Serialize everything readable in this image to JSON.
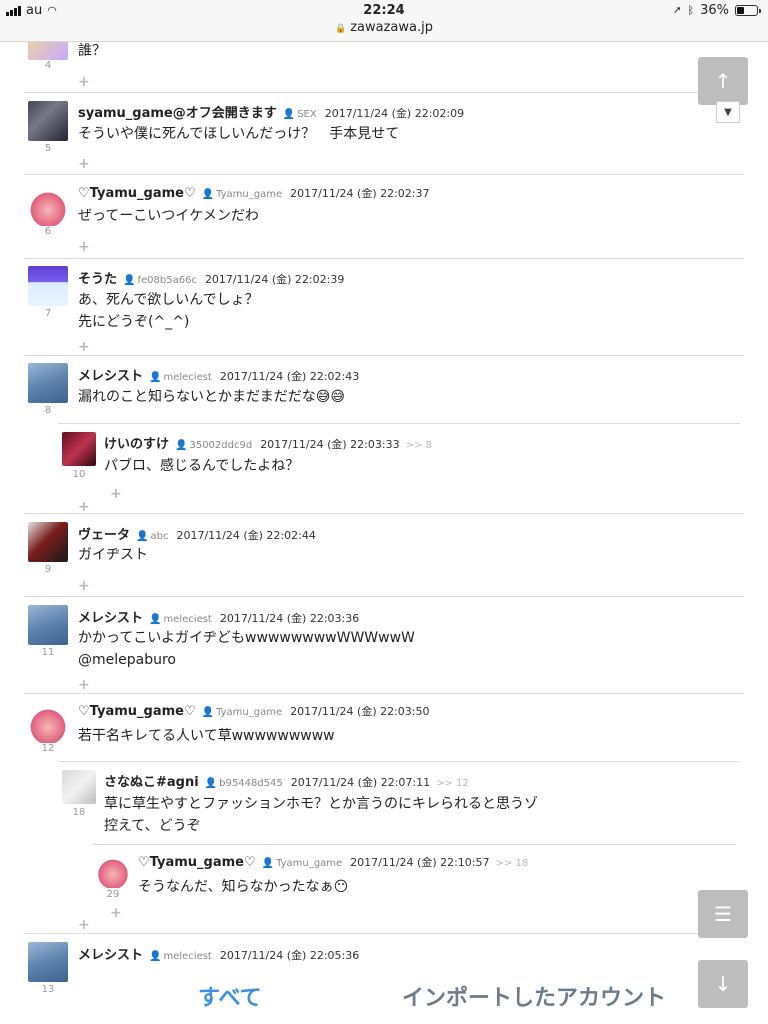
{
  "status_bar": {
    "carrier": "au",
    "time": "22:24",
    "battery": "36%",
    "battery_level": 0.36
  },
  "url_bar": {
    "url": "zawazawa.jp"
  },
  "first_comment": {
    "number": "4",
    "body": "誰？"
  },
  "comments": [
    {
      "number": "5",
      "name": "syamu_game@オフ会開きます",
      "uid": "SEX",
      "date": "2017/11/24 (金) 22:02:09",
      "lines": [
        "そういや僕に死んでほしいんだっけ？　手本見せて"
      ],
      "reply_to": ""
    },
    {
      "number": "6",
      "name": "♡Tyamu_game♡",
      "uid": "Tyamu_game",
      "date": "2017/11/24 (金) 22:02:37",
      "lines": [
        "ぜってーこいつイケメンだわ"
      ],
      "reply_to": ""
    },
    {
      "number": "7",
      "name": "そうた",
      "uid": "fe08b5a66c",
      "date": "2017/11/24 (金) 22:02:39",
      "lines": [
        "あ、死んで欲しいんでしょ？",
        "先にどうぞ(^_^)"
      ],
      "reply_to": ""
    },
    {
      "number": "8",
      "name": "メレシスト",
      "uid": "meleciest",
      "date": "2017/11/24 (金) 22:02:43",
      "lines": [
        "漏れのこと知らないとかまだまだだな😅😅"
      ],
      "reply_to": ""
    },
    {
      "number": "10",
      "name": "けいのすけ",
      "uid": "35002ddc9d",
      "date": "2017/11/24 (金) 22:03:33",
      "lines": [
        "パブロ、感じるんでしたよね？"
      ],
      "reply_to": ">> 8"
    },
    {
      "number": "9",
      "name": "ヴェータ",
      "uid": "abc",
      "date": "2017/11/24 (金) 22:02:44",
      "lines": [
        "ガイヂスト"
      ],
      "reply_to": ""
    },
    {
      "number": "11",
      "name": "メレシスト",
      "uid": "meleciest",
      "date": "2017/11/24 (金) 22:03:36",
      "lines": [
        "かかってこいよガイヂどもwwwwwwwwWWWwwW",
        "@melepaburo"
      ],
      "reply_to": ""
    },
    {
      "number": "12",
      "name": "♡Tyamu_game♡",
      "uid": "Tyamu_game",
      "date": "2017/11/24 (金) 22:03:50",
      "lines": [
        "若干名キレてる人いて草wwwwwwwww"
      ],
      "reply_to": ""
    },
    {
      "number": "18",
      "name": "さなぬこ#agni",
      "uid": "b95448d545",
      "date": "2017/11/24 (金) 22:07:11",
      "lines": [
        "草に草生やすとファッションホモ？とか言うのにキレられると思うゾ",
        "控えて、どうぞ"
      ],
      "reply_to": ">> 12"
    },
    {
      "number": "29",
      "name": "♡Tyamu_game♡",
      "uid": "Tyamu_game",
      "date": "2017/11/24 (金) 22:10:57",
      "lines": [
        "そうなんだ、知らなかったなぁ😶"
      ],
      "reply_to": ">> 18"
    },
    {
      "number": "13",
      "name": "メレシスト",
      "uid": "meleciest",
      "date": "2017/11/24 (金) 22:05:36",
      "lines": [],
      "reply_to": ""
    }
  ],
  "icons": {
    "user": "user-icon",
    "add": "plus-icon",
    "up": "arrow-up-icon",
    "down": "arrow-down-icon",
    "menu": "hamburger-icon",
    "collapse": "chevron-down-icon",
    "lock": "lock-icon",
    "wifi": "wifi-icon",
    "bluetooth": "bluetooth-icon",
    "location": "location-arrow-icon"
  },
  "floating_buttons": {
    "up": "↑",
    "menu": "☰",
    "down": "↓"
  },
  "bottom_tabs": {
    "all": "すべて",
    "imported": "インポートしたアカウント"
  },
  "colors": {
    "accent_blue": "#3c8fe0",
    "tab_gray": "#6d7b8a",
    "button_gray": "#bdbdbd"
  }
}
